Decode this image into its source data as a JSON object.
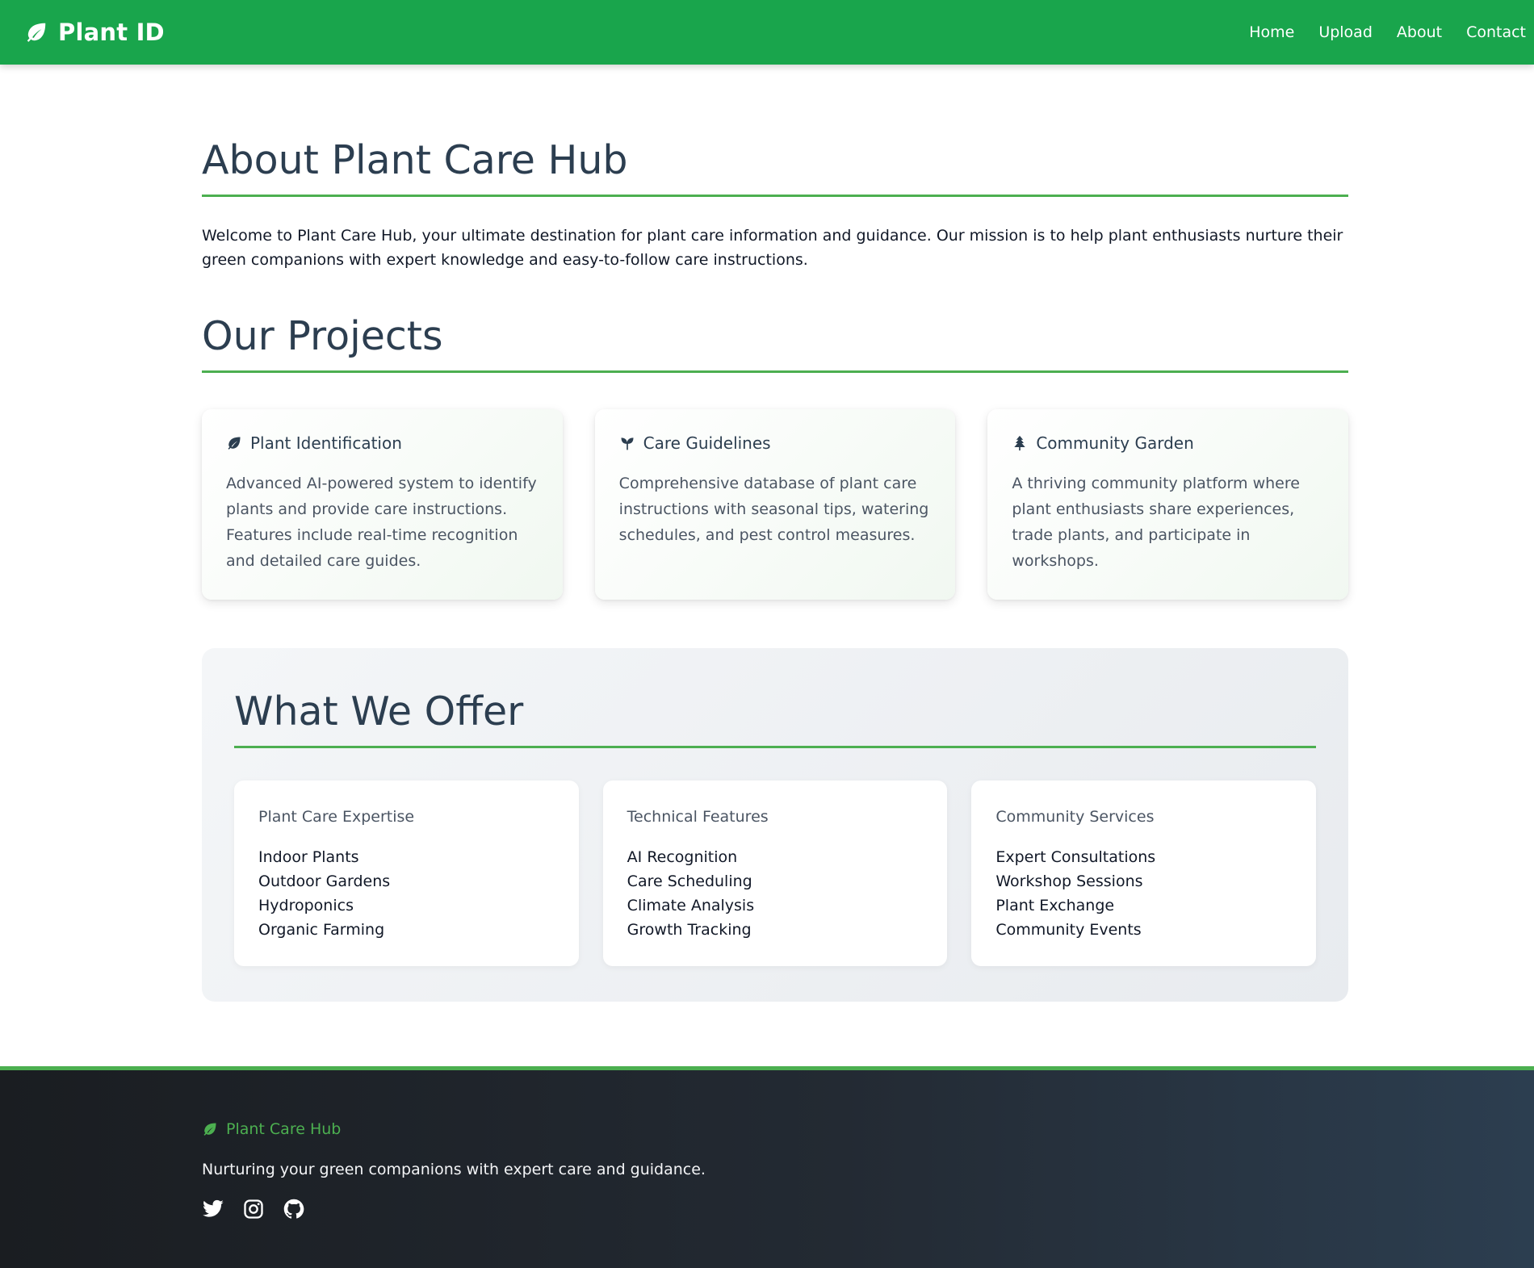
{
  "navbar": {
    "brand": "Plant ID",
    "brand_icon": "leaf-icon",
    "links": [
      "Home",
      "Upload",
      "About",
      "Contact"
    ]
  },
  "about": {
    "heading": "About Plant Care Hub",
    "intro": "Welcome to Plant Care Hub, your ultimate destination for plant care information and guidance. Our mission is to help plant enthusiasts nurture their green companions with expert knowledge and easy-to-follow care instructions."
  },
  "projects": {
    "heading": "Our Projects",
    "items": [
      {
        "icon": "leaf-icon",
        "title": "Plant Identification",
        "description": "Advanced AI-powered system to identify plants and provide care instructions. Features include real-time recognition and detailed care guides."
      },
      {
        "icon": "seedling-icon",
        "title": "Care Guidelines",
        "description": "Comprehensive database of plant care instructions with seasonal tips, watering schedules, and pest control measures."
      },
      {
        "icon": "tree-icon",
        "title": "Community Garden",
        "description": "A thriving community platform where plant enthusiasts share experiences, trade plants, and participate in workshops."
      }
    ]
  },
  "offer": {
    "heading": "What We Offer",
    "cards": [
      {
        "title": "Plant Care Expertise",
        "items": [
          "Indoor Plants",
          "Outdoor Gardens",
          "Hydroponics",
          "Organic Farming"
        ]
      },
      {
        "title": "Technical Features",
        "items": [
          "AI Recognition",
          "Care Scheduling",
          "Climate Analysis",
          "Growth Tracking"
        ]
      },
      {
        "title": "Community Services",
        "items": [
          "Expert Consultations",
          "Workshop Sessions",
          "Plant Exchange",
          "Community Events"
        ]
      }
    ]
  },
  "footer": {
    "brand": "Plant Care Hub",
    "tagline": "Nurturing your green companions with expert care and guidance.",
    "socials": [
      "twitter-icon",
      "instagram-icon",
      "github-icon"
    ]
  },
  "colors": {
    "navbar": "#19a54c",
    "accent": "#4caf50",
    "heading": "#2c3e50",
    "footer": "#1a1d21"
  }
}
